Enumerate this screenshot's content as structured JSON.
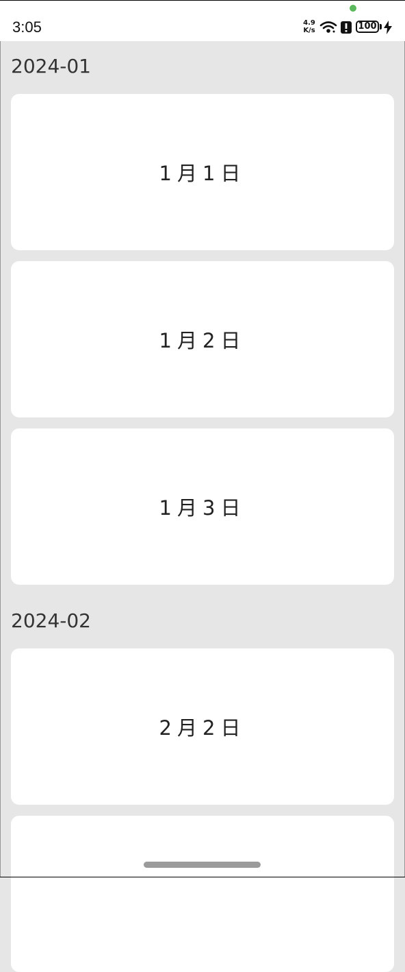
{
  "status_bar": {
    "time": "3:05",
    "net_speed_value": "4.9",
    "net_speed_unit": "K/s",
    "battery_level": "100",
    "icons": [
      "wifi-icon",
      "alert-icon",
      "battery-icon",
      "charge-icon"
    ]
  },
  "sections": [
    {
      "title": "2024-01",
      "items": [
        {
          "label": "1月1日"
        },
        {
          "label": "1月2日"
        },
        {
          "label": "1月3日"
        }
      ]
    },
    {
      "title": "2024-02",
      "items": [
        {
          "label": "2月2日"
        },
        {
          "label": ""
        }
      ]
    }
  ],
  "colors": {
    "background": "#e6e6e6",
    "card": "#ffffff",
    "camera_dot": "#5cb85c",
    "home_indicator": "#9b9b9b"
  }
}
